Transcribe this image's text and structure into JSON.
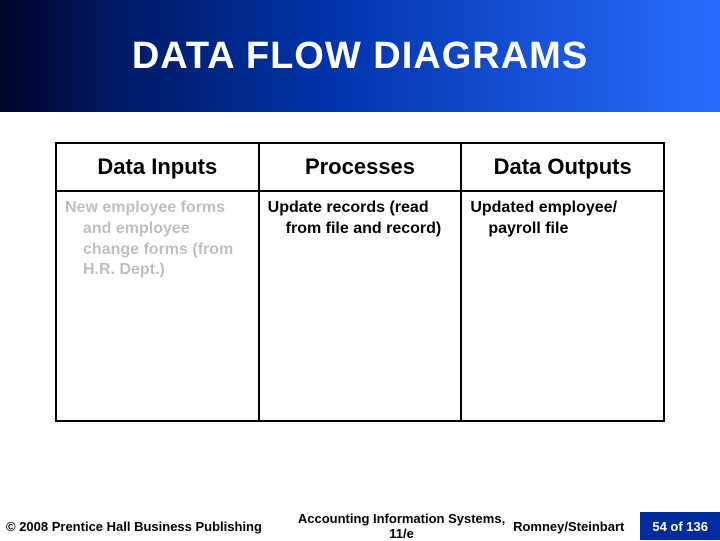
{
  "title": "DATA FLOW DIAGRAMS",
  "table": {
    "headers": [
      "Data Inputs",
      "Processes",
      "Data Outputs"
    ],
    "rows": [
      {
        "inputs": "New employee forms and employee change forms (from H.R. Dept.)",
        "processes": "Update records (read from file and record)",
        "outputs": "Updated employee/ payroll file"
      }
    ]
  },
  "footer": {
    "copyright": "© 2008 Prentice Hall Business Publishing",
    "book": "Accounting Information Systems, 11/e",
    "authors": "Romney/Steinbart",
    "page": "54 of 136"
  }
}
